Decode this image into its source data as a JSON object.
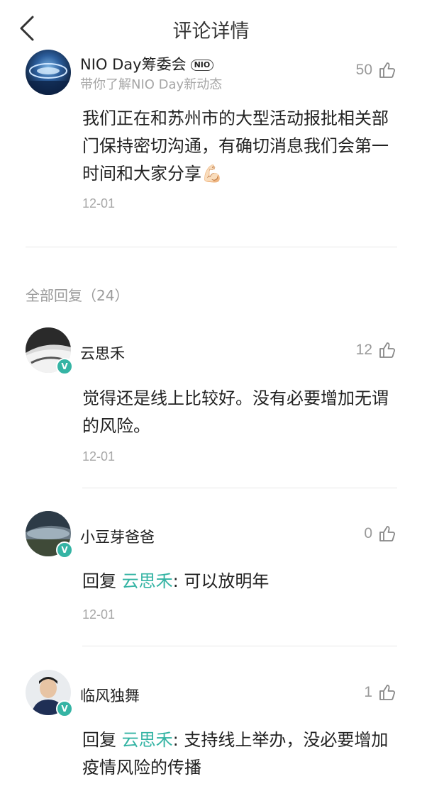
{
  "header": {
    "title": "评论详情"
  },
  "main_comment": {
    "author": "NIO Day筹委会",
    "badge": "NIO",
    "subtitle": "带你了解NIO Day新动态",
    "likes": "50",
    "text": "我们正在和苏州市的大型活动报批相关部门保持密切沟通，有确切消息我们会第一时间和大家分享💪🏻",
    "date": "12-01"
  },
  "replies_header": "全部回复（24）",
  "reply_prefix": "回复",
  "replies": [
    {
      "author": "云思禾",
      "likes": "12",
      "text": "觉得还是线上比较好。没有必要增加无谓的风险。",
      "date": "12-01"
    },
    {
      "author": "小豆芽爸爸",
      "likes": "0",
      "mention": "云思禾",
      "text": ": 可以放明年",
      "date": "12-01"
    },
    {
      "author": "临风独舞",
      "likes": "1",
      "mention": "云思禾",
      "text": ": 支持线上举办，没必要增加疫情风险的传播"
    }
  ],
  "colors": {
    "accent": "#35b4a4",
    "muted": "#a6a6a6",
    "divider": "#e8e8e8"
  },
  "icons": {
    "back": "chevron-left-icon",
    "like": "thumbs-up-icon",
    "verified": "verified-v-icon"
  }
}
